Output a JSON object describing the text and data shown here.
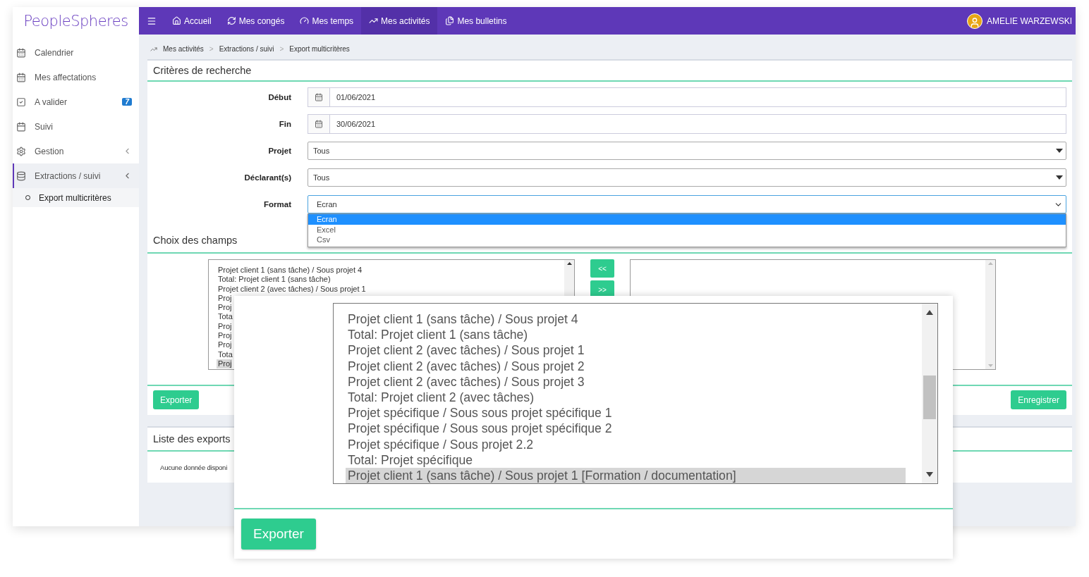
{
  "logo": {
    "text": "PeopleSpheres"
  },
  "navbar": {
    "items": [
      {
        "label": "Accueil",
        "selected": false
      },
      {
        "label": "Mes congés",
        "selected": false
      },
      {
        "label": "Mes temps",
        "selected": false
      },
      {
        "label": "Mes activités",
        "selected": true
      },
      {
        "label": "Mes bulletins",
        "selected": false
      }
    ],
    "user": {
      "name": "AMELIE WARZEWSKI"
    }
  },
  "sidebar": {
    "items": [
      {
        "label": "Calendrier",
        "selected": false
      },
      {
        "label": "Mes affectations",
        "selected": false
      },
      {
        "label": "A valider",
        "badge": "7",
        "selected": false
      },
      {
        "label": "Suivi",
        "selected": false
      },
      {
        "label": "Gestion",
        "expanded": false,
        "selected": false
      },
      {
        "label": "Extractions / suivi",
        "expanded": true,
        "selected": true,
        "children": [
          {
            "label": "Export multicritères",
            "selected": true
          }
        ]
      }
    ]
  },
  "breadcrumb": {
    "separator": ">",
    "items": [
      "Mes activités",
      "Extractions / suivi",
      "Export multicritères"
    ]
  },
  "criteria": {
    "title": "Critères de recherche",
    "fields": [
      {
        "kind": "date",
        "label": "Début",
        "value": "01/06/2021"
      },
      {
        "kind": "date",
        "label": "Fin",
        "value": "30/06/2021"
      },
      {
        "kind": "select",
        "label": "Projet",
        "value": "Tous"
      },
      {
        "kind": "select",
        "label": "Déclarant(s)",
        "value": "Tous"
      },
      {
        "kind": "select",
        "label": "Format",
        "value": "Ecran",
        "expanded": true,
        "options": [
          {
            "label": "Ecran",
            "selected": true
          },
          {
            "label": "Excel",
            "selected": false
          },
          {
            "label": "Csv",
            "selected": false
          }
        ]
      }
    ]
  },
  "fields_choice": {
    "title": "Choix des champs",
    "available": [
      {
        "label": "Projet client 1 (sans tâche) / Sous projet 4",
        "selected": false
      },
      {
        "label": "Total: Projet client 1 (sans tâche)",
        "selected": false
      },
      {
        "label": "Projet client 2 (avec tâches) / Sous projet 1",
        "selected": false
      },
      {
        "label": "Proj",
        "selected": false
      },
      {
        "label": "Proj",
        "selected": false
      },
      {
        "label": "Tota",
        "selected": false
      },
      {
        "label": "Proj",
        "selected": false
      },
      {
        "label": "Proj",
        "selected": false
      },
      {
        "label": "Proj",
        "selected": false
      },
      {
        "label": "Tota",
        "selected": false
      },
      {
        "label": "Proj",
        "selected": true
      }
    ],
    "move_buttons": [
      "<<",
      ">>"
    ],
    "export_button": "Exporter",
    "save_button": "Enregistrer"
  },
  "exports": {
    "title": "Liste des exports",
    "empty_text": "Aucune donnée disponi"
  },
  "zoom_inset": {
    "items": [
      {
        "label": "Projet client 1 (sans tâche) / Sous projet 4",
        "selected": false
      },
      {
        "label": "Total: Projet client 1 (sans tâche)",
        "selected": false
      },
      {
        "label": "Projet client 2 (avec tâches) / Sous projet 1",
        "selected": false
      },
      {
        "label": "Projet client 2 (avec tâches) / Sous projet 2",
        "selected": false
      },
      {
        "label": "Projet client 2 (avec tâches) / Sous projet 3",
        "selected": false
      },
      {
        "label": "Total: Projet client 2 (avec tâches)",
        "selected": false
      },
      {
        "label": "Projet spécifique / Sous sous projet spécifique 1",
        "selected": false
      },
      {
        "label": "Projet spécifique / Sous sous projet spécifique 2",
        "selected": false
      },
      {
        "label": "Projet spécifique / Sous projet 2.2",
        "selected": false
      },
      {
        "label": "Total: Projet spécifique",
        "selected": false
      },
      {
        "label": "Projet client 1 (sans tâche) / Sous projet 1 [Formation / documentation]",
        "selected": true
      }
    ],
    "button": "Exporter"
  }
}
